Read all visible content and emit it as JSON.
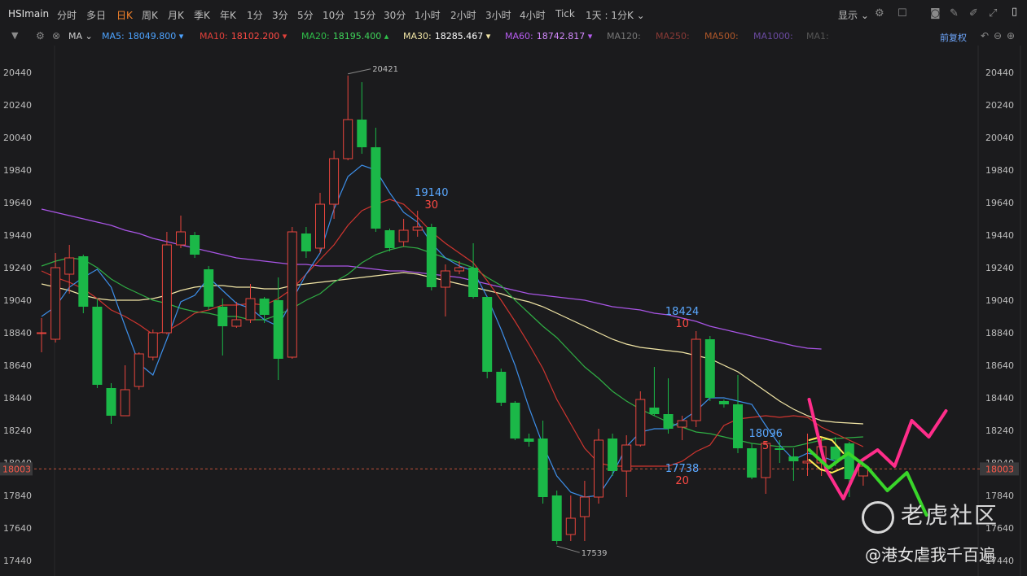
{
  "app": {
    "symbol": "HSImain"
  },
  "toolbar": {
    "periods": [
      "分时",
      "多日",
      "日K",
      "周K",
      "月K",
      "季K",
      "年K",
      "1分",
      "3分",
      "5分",
      "10分",
      "15分",
      "30分",
      "1小时",
      "2小时",
      "3小时",
      "4小时",
      "Tick"
    ],
    "active_period": "日K",
    "range_label": "1天 : 1分K",
    "display_label": "显示"
  },
  "indicators": {
    "type": "MA",
    "fuquan": "前复权",
    "items": [
      {
        "name": "MA5:",
        "value": "18049.800",
        "arrow": "▾",
        "color": "#4da3ff"
      },
      {
        "name": "MA10:",
        "value": "18102.200",
        "arrow": "▾",
        "color": "#e0403a"
      },
      {
        "name": "MA20:",
        "value": "18195.400",
        "arrow": "▴",
        "color": "#2fbf4a"
      },
      {
        "name": "MA30:",
        "value": "18285.467",
        "arrow": "▾",
        "color": "#f2e6a6"
      },
      {
        "name": "MA60:",
        "value": "18742.817",
        "arrow": "▾",
        "color": "#b65cf0"
      },
      {
        "name": "MA120:",
        "value": "",
        "arrow": "",
        "color": "#777777"
      },
      {
        "name": "MA250:",
        "value": "",
        "arrow": "",
        "color": "#8a3a36"
      },
      {
        "name": "MA500:",
        "value": "",
        "arrow": "",
        "color": "#b0582a"
      },
      {
        "name": "MA1000:",
        "value": "",
        "arrow": "",
        "color": "#6a4aa0"
      },
      {
        "name": "MA1:",
        "value": "",
        "arrow": "",
        "color": "#555555"
      }
    ]
  },
  "chart_data": {
    "type": "candlestick",
    "ylim": [
      17400,
      20550
    ],
    "y_ticks": [
      20440,
      20240,
      20040,
      19840,
      19640,
      19440,
      19240,
      19040,
      18840,
      18640,
      18440,
      18240,
      18040,
      17840,
      17640,
      17440
    ],
    "current_price_label": "18003",
    "current_price": 18003,
    "high_label": "20421",
    "low_label": "17539",
    "candles": [
      {
        "o": 18840,
        "c": 18840,
        "h": 18930,
        "l": 18720
      },
      {
        "o": 18800,
        "c": 19240,
        "h": 19330,
        "l": 18780
      },
      {
        "o": 19200,
        "c": 19300,
        "h": 19380,
        "l": 19080
      },
      {
        "o": 19310,
        "c": 19000,
        "h": 19320,
        "l": 18960
      },
      {
        "o": 19000,
        "c": 18520,
        "h": 19050,
        "l": 18500
      },
      {
        "o": 18500,
        "c": 18330,
        "h": 18530,
        "l": 18280
      },
      {
        "o": 18330,
        "c": 18490,
        "h": 18640,
        "l": 18330
      },
      {
        "o": 18510,
        "c": 18710,
        "h": 18720,
        "l": 18490
      },
      {
        "o": 18690,
        "c": 18840,
        "h": 18860,
        "l": 18670
      },
      {
        "o": 18840,
        "c": 19380,
        "h": 19460,
        "l": 18830
      },
      {
        "o": 19380,
        "c": 19460,
        "h": 19560,
        "l": 19360
      },
      {
        "o": 19440,
        "c": 19320,
        "h": 19460,
        "l": 19300
      },
      {
        "o": 19230,
        "c": 19000,
        "h": 19250,
        "l": 18980
      },
      {
        "o": 19000,
        "c": 18880,
        "h": 19050,
        "l": 18700
      },
      {
        "o": 18880,
        "c": 18920,
        "h": 19030,
        "l": 18870
      },
      {
        "o": 18920,
        "c": 19050,
        "h": 19140,
        "l": 18900
      },
      {
        "o": 19050,
        "c": 18950,
        "h": 19060,
        "l": 18900
      },
      {
        "o": 19040,
        "c": 18680,
        "h": 19180,
        "l": 18550
      },
      {
        "o": 18690,
        "c": 19460,
        "h": 19490,
        "l": 18680
      },
      {
        "o": 19450,
        "c": 19340,
        "h": 19490,
        "l": 19300
      },
      {
        "o": 19360,
        "c": 19630,
        "h": 19700,
        "l": 19330
      },
      {
        "o": 19630,
        "c": 19910,
        "h": 19960,
        "l": 19540
      },
      {
        "o": 19910,
        "c": 20150,
        "h": 20421,
        "l": 19900
      },
      {
        "o": 20150,
        "c": 19980,
        "h": 20380,
        "l": 19940
      },
      {
        "o": 19980,
        "c": 19480,
        "h": 20100,
        "l": 19460
      },
      {
        "o": 19470,
        "c": 19360,
        "h": 19480,
        "l": 19340
      },
      {
        "o": 19400,
        "c": 19470,
        "h": 19540,
        "l": 19370
      },
      {
        "o": 19470,
        "c": 19490,
        "h": 19590,
        "l": 19430
      },
      {
        "o": 19490,
        "c": 19120,
        "h": 19510,
        "l": 19100
      },
      {
        "o": 19120,
        "c": 19220,
        "h": 19260,
        "l": 18940
      },
      {
        "o": 19220,
        "c": 19240,
        "h": 19280,
        "l": 19200
      },
      {
        "o": 19240,
        "c": 19060,
        "h": 19390,
        "l": 19050
      },
      {
        "o": 19060,
        "c": 18600,
        "h": 19060,
        "l": 18560
      },
      {
        "o": 18600,
        "c": 18410,
        "h": 18620,
        "l": 18390
      },
      {
        "o": 18410,
        "c": 18190,
        "h": 18420,
        "l": 18180
      },
      {
        "o": 18190,
        "c": 18170,
        "h": 18220,
        "l": 18140
      },
      {
        "o": 18190,
        "c": 17830,
        "h": 18300,
        "l": 17790
      },
      {
        "o": 17840,
        "c": 17560,
        "h": 17870,
        "l": 17539
      },
      {
        "o": 17600,
        "c": 17700,
        "h": 17840,
        "l": 17560
      },
      {
        "o": 17710,
        "c": 17830,
        "h": 17930,
        "l": 17560
      },
      {
        "o": 17830,
        "c": 18180,
        "h": 18250,
        "l": 17790
      },
      {
        "o": 18190,
        "c": 17990,
        "h": 18220,
        "l": 17960
      },
      {
        "o": 17990,
        "c": 18150,
        "h": 18210,
        "l": 17830
      },
      {
        "o": 18150,
        "c": 18430,
        "h": 18480,
        "l": 18140
      },
      {
        "o": 18380,
        "c": 18340,
        "h": 18630,
        "l": 18330
      },
      {
        "o": 18340,
        "c": 18250,
        "h": 18560,
        "l": 18220
      },
      {
        "o": 18260,
        "c": 18300,
        "h": 18330,
        "l": 18180
      },
      {
        "o": 18300,
        "c": 18800,
        "h": 18850,
        "l": 18260
      },
      {
        "o": 18800,
        "c": 18440,
        "h": 18820,
        "l": 18420
      },
      {
        "o": 18420,
        "c": 18400,
        "h": 18430,
        "l": 18380
      },
      {
        "o": 18400,
        "c": 18130,
        "h": 18580,
        "l": 18100
      },
      {
        "o": 18130,
        "c": 17950,
        "h": 18160,
        "l": 17940
      },
      {
        "o": 17950,
        "c": 18160,
        "h": 18170,
        "l": 17850
      },
      {
        "o": 18130,
        "c": 18120,
        "h": 18180,
        "l": 18040
      },
      {
        "o": 18080,
        "c": 18050,
        "h": 18130,
        "l": 17930
      },
      {
        "o": 18040,
        "c": 18050,
        "h": 18220,
        "l": 17960
      },
      {
        "o": 18040,
        "c": 18140,
        "h": 18200,
        "l": 17960
      },
      {
        "o": 18140,
        "c": 18060,
        "h": 18200,
        "l": 18020
      },
      {
        "o": 18160,
        "c": 17940,
        "h": 18170,
        "l": 17830
      },
      {
        "o": 17960,
        "c": 18020,
        "h": 18040,
        "l": 17900
      }
    ],
    "ma5": [
      18940,
      19000,
      19120,
      19180,
      19230,
      19120,
      18880,
      18650,
      18580,
      18800,
      19030,
      19070,
      19180,
      19100,
      19020,
      18990,
      18920,
      18880,
      19040,
      19200,
      19330,
      19600,
      19800,
      19870,
      19840,
      19700,
      19580,
      19520,
      19390,
      19300,
      19250,
      19220,
      19060,
      18860,
      18640,
      18380,
      18150,
      17960,
      17860,
      17830,
      17840,
      17970,
      18140,
      18230,
      18250,
      18250,
      18300,
      18360,
      18440,
      18440,
      18420,
      18400,
      18270,
      18150,
      18060,
      18100,
      18080,
      18050,
      18080,
      18050
    ],
    "ma10": [
      19220,
      19180,
      19150,
      19110,
      19050,
      18980,
      18940,
      18890,
      18830,
      18850,
      18900,
      18960,
      18980,
      19010,
      19010,
      19020,
      19010,
      19050,
      19110,
      19200,
      19290,
      19380,
      19500,
      19590,
      19630,
      19660,
      19630,
      19550,
      19460,
      19390,
      19330,
      19270,
      19160,
      19040,
      18910,
      18770,
      18620,
      18430,
      18280,
      18130,
      18040,
      18020,
      18020,
      18020,
      18020,
      18020,
      18050,
      18110,
      18150,
      18270,
      18310,
      18320,
      18330,
      18320,
      18330,
      18320,
      18260,
      18220,
      18180,
      18140
    ],
    "ma20": [
      19250,
      19280,
      19300,
      19290,
      19240,
      19170,
      19120,
      19080,
      19040,
      19020,
      18990,
      18970,
      18960,
      18940,
      18940,
      18920,
      18920,
      18950,
      18990,
      19040,
      19080,
      19150,
      19200,
      19270,
      19320,
      19350,
      19370,
      19360,
      19330,
      19300,
      19270,
      19240,
      19180,
      19130,
      19040,
      18960,
      18880,
      18810,
      18720,
      18630,
      18560,
      18480,
      18420,
      18370,
      18330,
      18290,
      18260,
      18230,
      18220,
      18200,
      18180,
      18160,
      18150,
      18140,
      18140,
      18160,
      18180,
      18190,
      18195,
      18200
    ],
    "ma30": [
      19140,
      19120,
      19100,
      19070,
      19050,
      19040,
      19040,
      19040,
      19050,
      19070,
      19100,
      19120,
      19130,
      19130,
      19120,
      19120,
      19110,
      19110,
      19130,
      19140,
      19150,
      19160,
      19170,
      19180,
      19190,
      19200,
      19210,
      19200,
      19180,
      19160,
      19140,
      19120,
      19100,
      19080,
      19050,
      19030,
      19000,
      18960,
      18920,
      18880,
      18840,
      18800,
      18770,
      18750,
      18740,
      18730,
      18720,
      18700,
      18680,
      18640,
      18600,
      18540,
      18480,
      18420,
      18370,
      18330,
      18300,
      18290,
      18285,
      18280
    ],
    "ma60": [
      19600,
      19580,
      19560,
      19540,
      19520,
      19500,
      19470,
      19450,
      19420,
      19400,
      19380,
      19360,
      19340,
      19320,
      19300,
      19290,
      19280,
      19270,
      19260,
      19260,
      19250,
      19250,
      19250,
      19240,
      19230,
      19220,
      19220,
      19210,
      19200,
      19190,
      19180,
      19160,
      19140,
      19120,
      19100,
      19080,
      19070,
      19060,
      19050,
      19040,
      19020,
      19000,
      18990,
      18980,
      18960,
      18950,
      18930,
      18910,
      18880,
      18860,
      18840,
      18820,
      18800,
      18780,
      18760,
      18745,
      18740,
      null,
      null,
      null
    ],
    "annotations": [
      {
        "index": 28,
        "price": 19680,
        "top": "19140",
        "bottom": "30"
      },
      {
        "index": 46,
        "price": 17985,
        "top": "17738",
        "bottom": "20"
      },
      {
        "index": 46,
        "price": 18950,
        "top": "18424",
        "bottom": "10"
      },
      {
        "index": 52,
        "price": 18200,
        "top": "18096",
        "bottom": "5"
      }
    ],
    "drawings": {
      "magenta": [
        [
          18430
        ],
        [
          18000
        ],
        [
          17820
        ],
        [
          18050
        ],
        [
          18120
        ],
        [
          18020
        ],
        [
          18300
        ],
        [
          18200
        ],
        [
          18360
        ]
      ],
      "green": [
        [
          18120
        ],
        [
          18010
        ],
        [
          18100
        ],
        [
          18010
        ],
        [
          17870
        ],
        [
          17980
        ],
        [
          17720
        ]
      ],
      "yellow_fan_top": [
        18180,
        18200,
        18180,
        18100
      ],
      "yellow_fan_bottom": [
        18060,
        18000,
        17980,
        18010
      ]
    }
  },
  "watermark": {
    "brand": "老虎社区",
    "user": "@港女虐我千百遍"
  }
}
